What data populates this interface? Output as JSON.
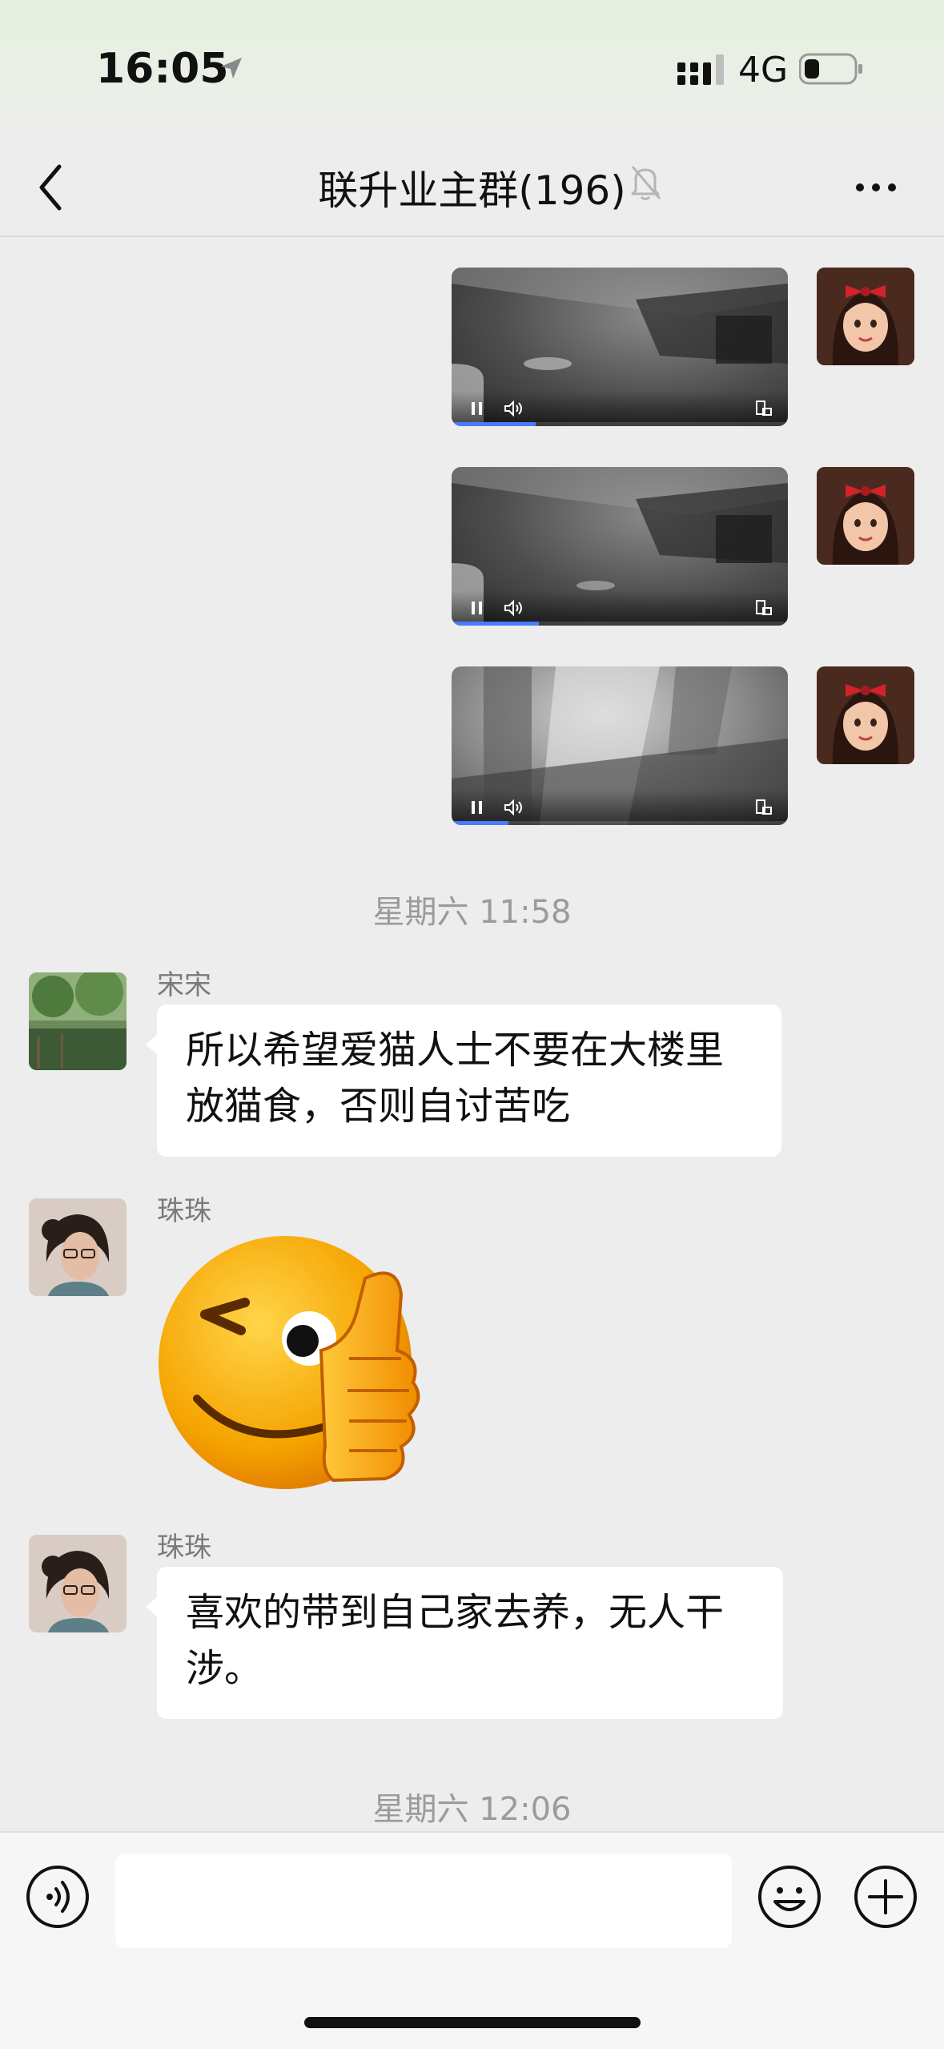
{
  "status_bar": {
    "time": "16:05",
    "network": "4G",
    "icons": [
      "location-arrow-icon",
      "signal-icon",
      "battery-icon"
    ]
  },
  "nav": {
    "title": "联升业主群(196)",
    "icons": [
      "back-icon",
      "mute-bell-icon",
      "more-icon"
    ]
  },
  "messages": {
    "videos": [
      {
        "from": "self",
        "progress": 0.25,
        "icons": [
          "pause-icon",
          "volume-icon",
          "screen-icon"
        ]
      },
      {
        "from": "self",
        "progress": 0.26,
        "icons": [
          "pause-icon",
          "volume-icon",
          "screen-icon"
        ]
      },
      {
        "from": "self",
        "progress": 0.17,
        "icons": [
          "pause-icon",
          "volume-icon",
          "screen-icon"
        ]
      }
    ],
    "timestamp_1": "星期六 11:58",
    "msg_songsong": {
      "sender": "宋宋",
      "lines": [
        "所以希望爱猫人士不要在大楼里",
        "放猫食，否则自讨苦吃"
      ]
    },
    "msg_zhuzhu_sticker": {
      "sender": "珠珠",
      "sticker": "wink-thumbs-up-emoji"
    },
    "msg_zhuzhu_text": {
      "sender": "珠珠",
      "lines": [
        "喜欢的带到自己家去养，无人干",
        "涉。"
      ]
    },
    "timestamp_2": "星期六 12:06"
  },
  "input_bar": {
    "text_value": "",
    "icons": [
      "voice-icon",
      "emoji-icon",
      "plus-icon"
    ]
  },
  "colors": {
    "background": "#ededed",
    "bubble": "#ffffff",
    "progress": "#4a7bff",
    "timestamp": "#9b9b9b"
  }
}
